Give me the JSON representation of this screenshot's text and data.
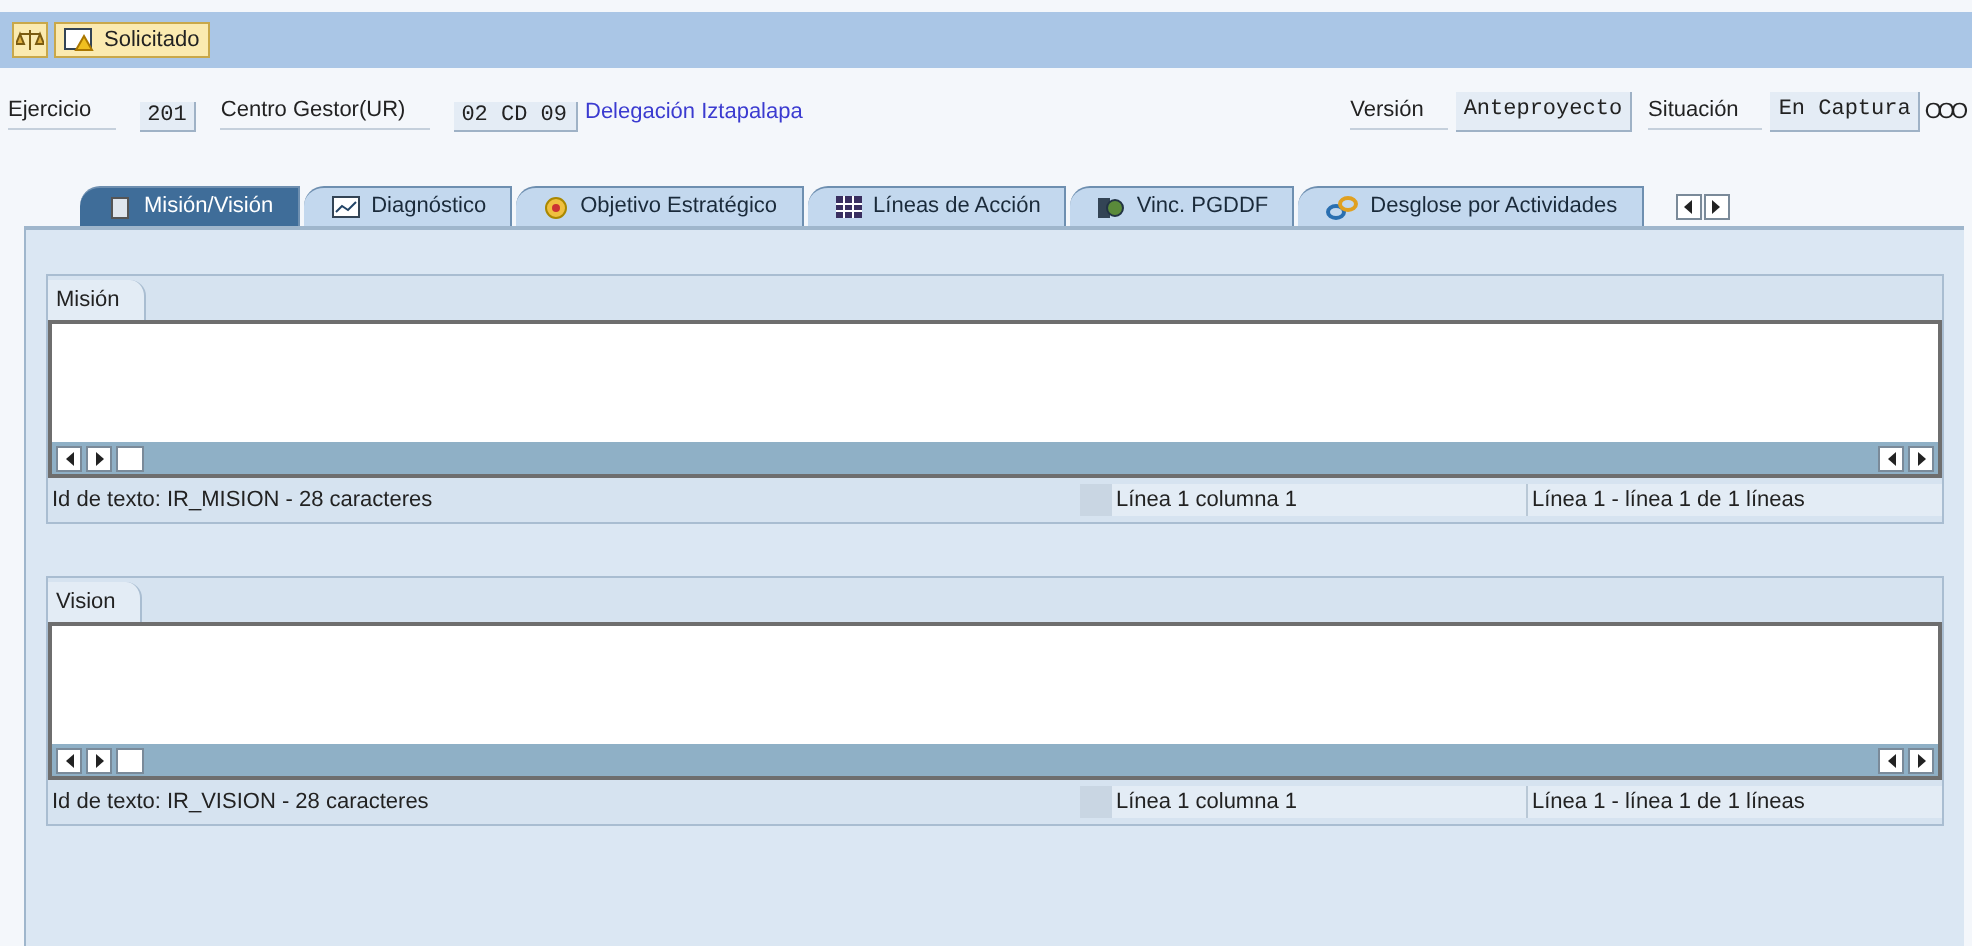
{
  "toolbar": {
    "button": "Solicitado"
  },
  "header": {
    "fields": [
      {
        "label": "Ejercicio",
        "value": "201"
      },
      {
        "label": "Centro Gestor(UR)",
        "value": "02 CD 09"
      }
    ],
    "description": "Delegación Iztapalapa",
    "right_fields": [
      {
        "label": "Versión",
        "value": "Anteproyecto"
      },
      {
        "label": "Situación",
        "value": "En Captura"
      }
    ],
    "status_glyph": "OOO"
  },
  "tabs": [
    {
      "label": "Misión/Visión",
      "selected": true
    },
    {
      "label": "Diagnóstico",
      "selected": false
    },
    {
      "label": "Objetivo Estratégico",
      "selected": false
    },
    {
      "label": "Líneas de Acción",
      "selected": false
    },
    {
      "label": "Vinc. PGDDF",
      "selected": false
    },
    {
      "label": "Desglose por Actividades",
      "selected": false
    }
  ],
  "sections": [
    {
      "title": "Misión",
      "text_id": "Id de texto: IR_MISION - 28 caracteres",
      "position": "Línea 1 columna 1",
      "lines": "Línea 1 - línea 1 de 1 líneas"
    },
    {
      "title": "Vision",
      "text_id": "Id de texto: IR_VISION - 28 caracteres",
      "position": "Línea 1 columna 1",
      "lines": "Línea 1 - línea 1 de 1 líneas"
    }
  ]
}
